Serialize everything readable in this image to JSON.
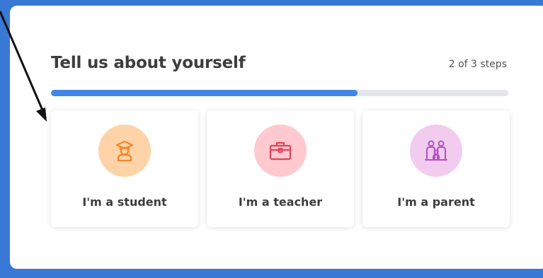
{
  "header": {
    "title": "Tell us about yourself",
    "steps": "2 of 3 steps"
  },
  "progress": {
    "fraction": 0.67,
    "fill_color": "#3f86e6",
    "track_color": "#e4e6ea"
  },
  "options": [
    {
      "label": "I'm a student",
      "icon": "graduate-icon",
      "bg": "#ffd3a8",
      "color": "#f08a2a"
    },
    {
      "label": "I'm a teacher",
      "icon": "briefcase-icon",
      "bg": "#ffc9cf",
      "color": "#e2445a"
    },
    {
      "label": "I'm a parent",
      "icon": "family-icon",
      "bg": "#f2ccee",
      "color": "#b54fc9"
    }
  ],
  "colors": {
    "frame": "#3a78d6",
    "card": "#ffffff",
    "text": "#3d3d3d"
  }
}
